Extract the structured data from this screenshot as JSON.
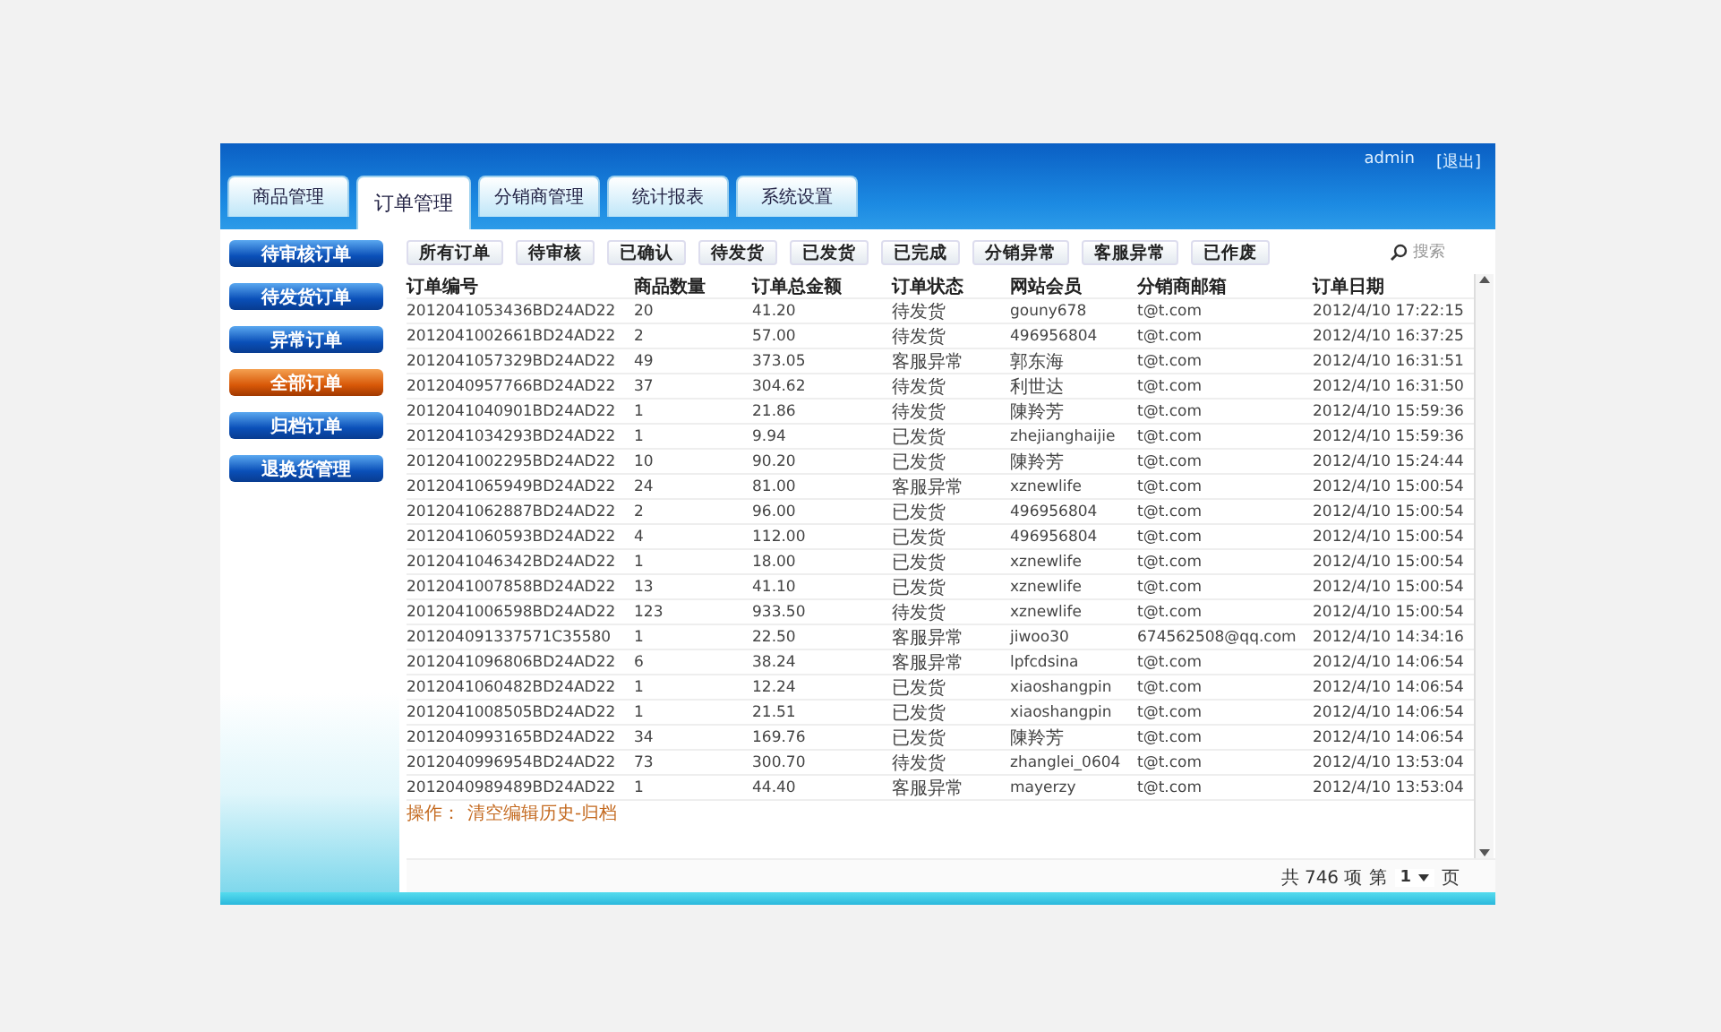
{
  "header": {
    "user": "admin",
    "logout": "[退出]"
  },
  "tabs": [
    {
      "label": "商品管理",
      "selected": false
    },
    {
      "label": "订单管理",
      "selected": true
    },
    {
      "label": "分销商管理",
      "selected": false
    },
    {
      "label": "统计报表",
      "selected": false
    },
    {
      "label": "系统设置",
      "selected": false
    }
  ],
  "sidebar": {
    "items": [
      {
        "label": "待审核订单",
        "selected": false
      },
      {
        "label": "待发货订单",
        "selected": false
      },
      {
        "label": "异常订单",
        "selected": false
      },
      {
        "label": "全部订单",
        "selected": true
      },
      {
        "label": "归档订单",
        "selected": false
      },
      {
        "label": "退换货管理",
        "selected": false
      }
    ]
  },
  "filters": [
    "所有订单",
    "待审核",
    "已确认",
    "待发货",
    "已发货",
    "已完成",
    "分销异常",
    "客服异常",
    "已作废"
  ],
  "search": {
    "placeholder": "搜索"
  },
  "table": {
    "columns": [
      "订单编号",
      "商品数量",
      "订单总金额",
      "订单状态",
      "网站会员",
      "分销商邮箱",
      "订单日期"
    ],
    "rows": [
      [
        "2012041053436BD24AD22",
        "20",
        "41.20",
        "待发货",
        "gouny678",
        "t@t.com",
        "2012/4/10 17:22:15"
      ],
      [
        "2012041002661BD24AD22",
        "2",
        "57.00",
        "待发货",
        "496956804",
        "t@t.com",
        "2012/4/10 16:37:25"
      ],
      [
        "2012041057329BD24AD22",
        "49",
        "373.05",
        "客服异常",
        "郭东海",
        "t@t.com",
        "2012/4/10 16:31:51"
      ],
      [
        "2012040957766BD24AD22",
        "37",
        "304.62",
        "待发货",
        "利世达",
        "t@t.com",
        "2012/4/10 16:31:50"
      ],
      [
        "2012041040901BD24AD22",
        "1",
        "21.86",
        "待发货",
        "陳羚芳",
        "t@t.com",
        "2012/4/10 15:59:36"
      ],
      [
        "2012041034293BD24AD22",
        "1",
        "9.94",
        "已发货",
        "zhejianghaijie",
        "t@t.com",
        "2012/4/10 15:59:36"
      ],
      [
        "2012041002295BD24AD22",
        "10",
        "90.20",
        "已发货",
        "陳羚芳",
        "t@t.com",
        "2012/4/10 15:24:44"
      ],
      [
        "2012041065949BD24AD22",
        "24",
        "81.00",
        "客服异常",
        "xznewlife",
        "t@t.com",
        "2012/4/10 15:00:54"
      ],
      [
        "2012041062887BD24AD22",
        "2",
        "96.00",
        "已发货",
        "496956804",
        "t@t.com",
        "2012/4/10 15:00:54"
      ],
      [
        "2012041060593BD24AD22",
        "4",
        "112.00",
        "已发货",
        "496956804",
        "t@t.com",
        "2012/4/10 15:00:54"
      ],
      [
        "2012041046342BD24AD22",
        "1",
        "18.00",
        "已发货",
        "xznewlife",
        "t@t.com",
        "2012/4/10 15:00:54"
      ],
      [
        "2012041007858BD24AD22",
        "13",
        "41.10",
        "已发货",
        "xznewlife",
        "t@t.com",
        "2012/4/10 15:00:54"
      ],
      [
        "2012041006598BD24AD22",
        "123",
        "933.50",
        "待发货",
        "xznewlife",
        "t@t.com",
        "2012/4/10 15:00:54"
      ],
      [
        "201204091337571C35580",
        "1",
        "22.50",
        "客服异常",
        "jiwoo30",
        "674562508@qq.com",
        "2012/4/10 14:34:16"
      ],
      [
        "2012041096806BD24AD22",
        "6",
        "38.24",
        "客服异常",
        "lpfcdsina",
        "t@t.com",
        "2012/4/10 14:06:54"
      ],
      [
        "2012041060482BD24AD22",
        "1",
        "12.24",
        "已发货",
        "xiaoshangpin",
        "t@t.com",
        "2012/4/10 14:06:54"
      ],
      [
        "2012041008505BD24AD22",
        "1",
        "21.51",
        "已发货",
        "xiaoshangpin",
        "t@t.com",
        "2012/4/10 14:06:54"
      ],
      [
        "2012040993165BD24AD22",
        "34",
        "169.76",
        "已发货",
        "陳羚芳",
        "t@t.com",
        "2012/4/10 14:06:54"
      ],
      [
        "2012040996954BD24AD22",
        "73",
        "300.70",
        "待发货",
        "zhanglei_0604",
        "t@t.com",
        "2012/4/10 13:53:04"
      ],
      [
        "2012040989489BD24AD22",
        "1",
        "44.40",
        "客服异常",
        "mayerzy",
        "t@t.com",
        "2012/4/10 13:53:04"
      ]
    ]
  },
  "actions": {
    "label": "操作：",
    "link": "清空编辑历史-归档"
  },
  "pagination": {
    "total": "共 746 项",
    "page_label": "第",
    "page": "1",
    "unit": "页"
  }
}
